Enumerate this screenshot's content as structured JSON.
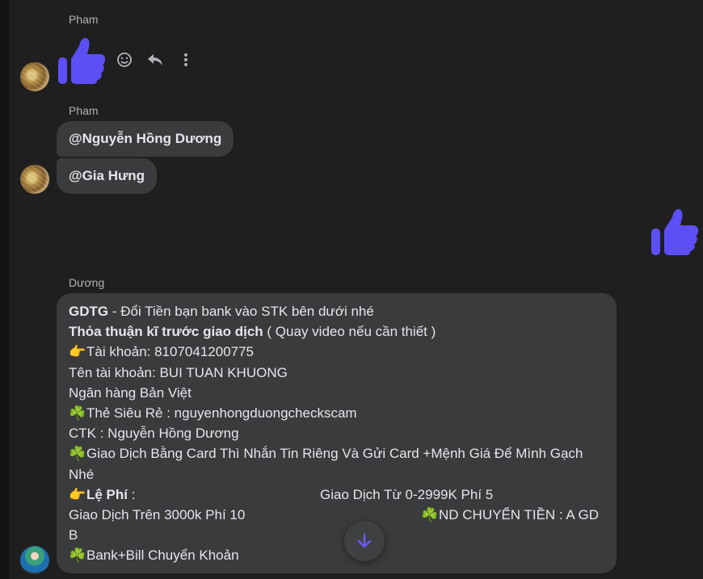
{
  "messages": [
    {
      "sender": "Pham",
      "type": "like"
    },
    {
      "sender": "Pham",
      "bubbles": [
        "@Nguyễn Hồng Dương",
        "@Gia Hưng"
      ]
    },
    {
      "sender": "",
      "type": "like",
      "self": true
    },
    {
      "sender": "Dương",
      "type": "text"
    }
  ],
  "msg1": {
    "sender": "Pham"
  },
  "msg2": {
    "sender": "Pham",
    "bubble1": "@Nguyễn Hồng Dương",
    "bubble2": "@Gia Hưng"
  },
  "msg4": {
    "sender": "Dương",
    "l1_bold": "GDTG",
    "l1_rest": " - Đổi Tiền bạn bank vào STK bên dưới nhé",
    "l2_bold": "Thỏa thuận kĩ trước giao dịch",
    "l2_rest": " ( Quay video nếu cần thiết )",
    "l3_emoji": "👉",
    "l3": "Tài khoản: 8107041200775",
    "l4": "Tên tài khoản: BUI TUAN KHUONG",
    "l5": "Ngân hàng Bản Việt",
    "l6_emoji": "☘️",
    "l6": "Thẻ Siêu Rẻ : nguyenhongduongcheckscam",
    "l7": "CTK : Nguyễn Hồng Dương",
    "l8_emoji": "☘️",
    "l8": "Giao Dịch Bằng Card Thì Nhắn Tin Riêng Và Gửi Card +Mệnh Giá Để Mình Gạch",
    "l9": "Nhé",
    "l10_emoji": "👉",
    "l10_bold": "Lệ Phí",
    "l10_colon": " :",
    "l10_right": "Giao Dịch Từ 0-2999K Phí 5",
    "l11_left": "Giao Dịch Trên 3000k Phí 10",
    "l11_emoji": "☘️",
    "l11_right": "ND CHUYỂN TIỀN : A GD",
    "l12": "B",
    "l13_emoji": "☘️",
    "l13": "Bank+Bill Chuyển Khoản"
  },
  "colors": {
    "like": "#5b4ff5",
    "bubble": "#3a3b3c",
    "background": "#1f1f1f"
  },
  "icons": [
    "emoji-icon",
    "reply-icon",
    "more-vertical-icon",
    "arrow-down-icon",
    "thumbs-up-icon"
  ]
}
